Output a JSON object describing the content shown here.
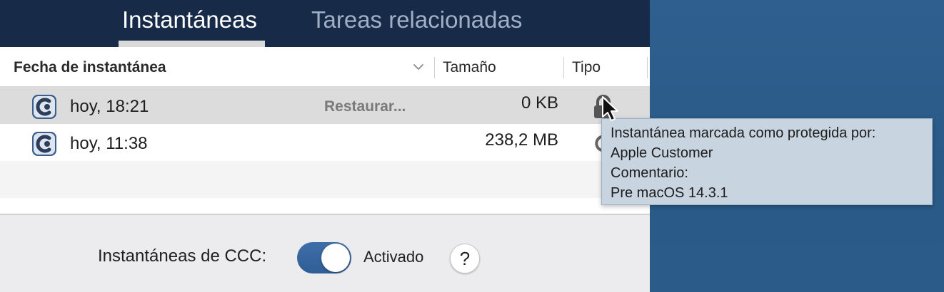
{
  "tabs": [
    {
      "label": "Instantáneas",
      "active": true
    },
    {
      "label": "Tareas relacionadas",
      "active": false
    }
  ],
  "table": {
    "columns": {
      "date": "Fecha de instantánea",
      "size": "Tamaño",
      "type": "Tipo"
    },
    "rows": [
      {
        "date": "hoy, 18:21",
        "action": "Restaurar...",
        "size": "0 KB",
        "type_icon": "lock-icon",
        "selected": true
      },
      {
        "date": "hoy, 11:38",
        "action": "",
        "size": "238,2 MB",
        "type_icon": "refresh-icon",
        "selected": false
      }
    ]
  },
  "tooltip": {
    "lines": [
      "Instantánea marcada como protegida por:",
      "Apple Customer",
      "Comentario:",
      "Pre macOS 14.3.1"
    ]
  },
  "footer": {
    "label": "Instantáneas de CCC:",
    "toggle_state": "Activado",
    "toggle_on": true,
    "help_label": "?"
  },
  "colors": {
    "tabbar": "#172a48",
    "accent": "#2f5d96",
    "desktop": "#2c5c89",
    "tooltip": "#c9d4e1"
  }
}
